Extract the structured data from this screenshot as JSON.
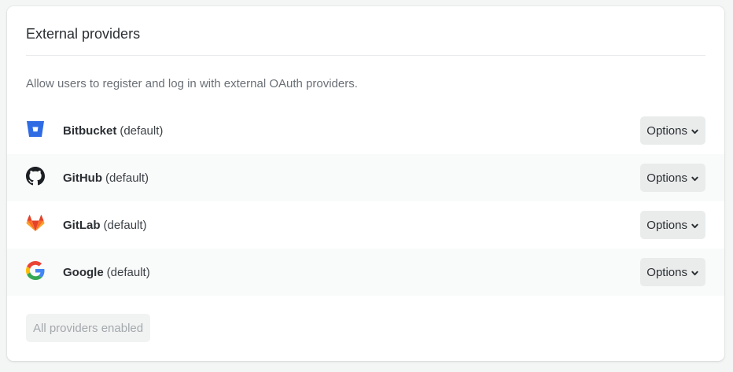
{
  "section": {
    "title": "External providers",
    "description": "Allow users to register and log in with external OAuth providers."
  },
  "providers": [
    {
      "name": "Bitbucket",
      "suffix": "(default)",
      "icon": "bitbucket-icon",
      "options_label": "Options"
    },
    {
      "name": "GitHub",
      "suffix": "(default)",
      "icon": "github-icon",
      "options_label": "Options"
    },
    {
      "name": "GitLab",
      "suffix": "(default)",
      "icon": "gitlab-icon",
      "options_label": "Options"
    },
    {
      "name": "Google",
      "suffix": "(default)",
      "icon": "google-icon",
      "options_label": "Options"
    }
  ],
  "footer": {
    "status_button_label": "All providers enabled",
    "enabled": false
  },
  "colors": {
    "bitbucket": "#2f6ce4",
    "github": "#1b1f23",
    "gitlab": "#e2432a",
    "google_blue": "#4285f4",
    "google_red": "#ea4335",
    "google_yellow": "#fbbc05",
    "google_green": "#34a853"
  }
}
